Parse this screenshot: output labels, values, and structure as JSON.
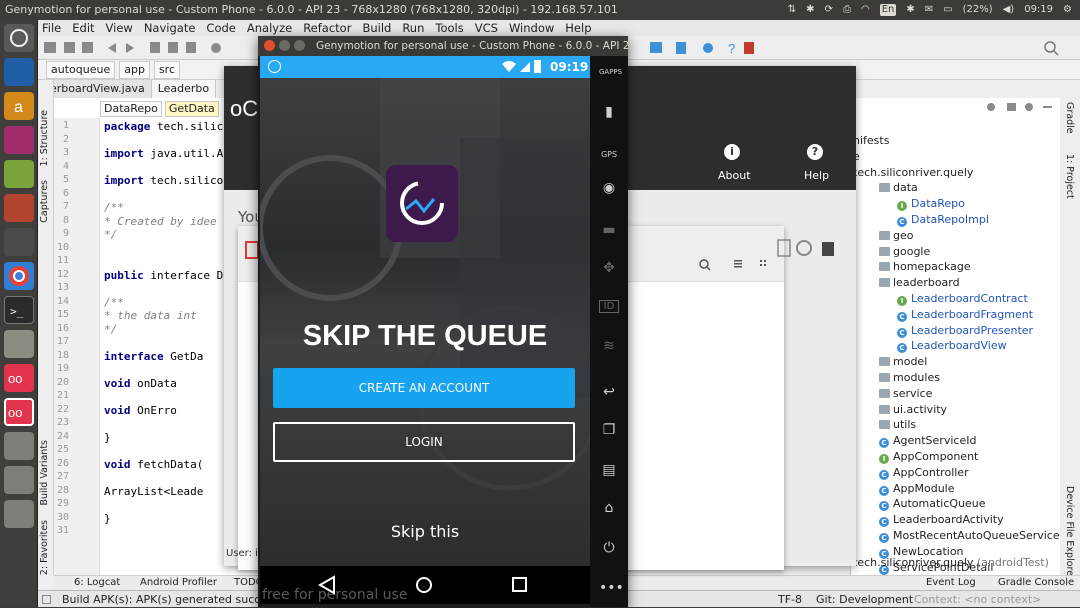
{
  "desktop": {
    "window_title": "Genymotion for personal use - Custom Phone - 6.0.0 - API 23 - 768x1280 (768x1280, 320dpi) - 192.168.57.101",
    "keyboard_layout": "En",
    "battery": "(22%)",
    "clock": "09:19"
  },
  "ide": {
    "menu": [
      "File",
      "Edit",
      "View",
      "Navigate",
      "Code",
      "Analyze",
      "Refactor",
      "Build",
      "Run",
      "Tools",
      "VCS",
      "Window",
      "Help"
    ],
    "breadcrumbs": [
      "autoqueue",
      "app",
      "src"
    ],
    "tabs": [
      "erboardView.java",
      "Leaderbo"
    ],
    "method_tabs": [
      "DataRepo",
      "GetData"
    ],
    "line_numbers": [
      "1",
      "2",
      "3",
      "4",
      "5",
      "6",
      "7",
      "8",
      "9",
      "10",
      "11",
      "12",
      "13",
      "14",
      "15",
      "16",
      "17",
      "18",
      "19",
      "20",
      "21",
      "22",
      "23",
      "24",
      "25",
      "26",
      "27",
      "28",
      "29",
      "30",
      "31"
    ],
    "code_lines": [
      {
        "line": 1,
        "text": "package tech.silico",
        "style": "kw-first"
      },
      {
        "line": 3,
        "text": "import java.util.Ar",
        "style": "kw-first"
      },
      {
        "line": 5,
        "text": "import tech.silicon",
        "style": "kw-first"
      },
      {
        "line": 7,
        "text": "/**",
        "style": "comment"
      },
      {
        "line": 8,
        "text": " * Created by idee",
        "style": "comment"
      },
      {
        "line": 9,
        "text": " */",
        "style": "comment"
      },
      {
        "line": 12,
        "text": "public interface Da",
        "style": "kw"
      },
      {
        "line": 14,
        "text": "    /**",
        "style": "comment"
      },
      {
        "line": 15,
        "text": "     * the data int",
        "style": "comment"
      },
      {
        "line": 16,
        "text": "     */",
        "style": "comment"
      },
      {
        "line": 18,
        "text": "    interface GetDa",
        "style": "kw"
      },
      {
        "line": 20,
        "text": "        void onData",
        "style": "kw"
      },
      {
        "line": 22,
        "text": "        void OnErro",
        "style": "kw"
      },
      {
        "line": 24,
        "text": "    }",
        "style": "plain"
      },
      {
        "line": 26,
        "text": "    void fetchData(",
        "style": "kw"
      },
      {
        "line": 28,
        "text": "    ArrayList<Leade",
        "style": "plain"
      },
      {
        "line": 30,
        "text": "}",
        "style": "plain"
      }
    ],
    "left_tool_labels": [
      "1: Structure",
      "Captures",
      "Build Variants",
      "2: Favorites"
    ],
    "right_tool_labels": [
      "Gradle",
      "1: Project",
      "Device File Explorer"
    ],
    "bottom_tools": [
      "6: Logcat",
      "Android Profiler",
      "TODO",
      "Event Log",
      "Gradle Console"
    ],
    "status_message": "Build APK(s): APK(s) generated successfull",
    "status_right": {
      "encoding": "TF-8",
      "git": "Git: Development",
      "context": "Context: <no context>"
    },
    "user_label": "User: id",
    "watermark": "free for personal use"
  },
  "project_tree": [
    {
      "label": "nifests",
      "kind": "plain",
      "indent": 0
    },
    {
      "label": "e",
      "kind": "plain",
      "indent": 0
    },
    {
      "label": "tech.siliconriver.quely",
      "kind": "plain",
      "indent": 0
    },
    {
      "label": "data",
      "kind": "folder",
      "indent": 1
    },
    {
      "label": "DataRepo",
      "kind": "interface",
      "indent": 2
    },
    {
      "label": "DataRepoImpl",
      "kind": "class",
      "indent": 2
    },
    {
      "label": "geo",
      "kind": "folder",
      "indent": 1
    },
    {
      "label": "google",
      "kind": "folder",
      "indent": 1
    },
    {
      "label": "homepackage",
      "kind": "folder",
      "indent": 1
    },
    {
      "label": "leaderboard",
      "kind": "folder",
      "indent": 1
    },
    {
      "label": "LeaderboardContract",
      "kind": "interface",
      "indent": 2
    },
    {
      "label": "LeaderboardFragment",
      "kind": "class",
      "indent": 2
    },
    {
      "label": "LeaderboardPresenter",
      "kind": "class",
      "indent": 2
    },
    {
      "label": "LeaderboardView",
      "kind": "class",
      "indent": 2
    },
    {
      "label": "model",
      "kind": "folder",
      "indent": 1
    },
    {
      "label": "modules",
      "kind": "folder",
      "indent": 1
    },
    {
      "label": "service",
      "kind": "folder",
      "indent": 1
    },
    {
      "label": "ui.activity",
      "kind": "folder",
      "indent": 1
    },
    {
      "label": "utils",
      "kind": "folder",
      "indent": 1
    },
    {
      "label": "AgentServiceId",
      "kind": "class-plain",
      "indent": 1
    },
    {
      "label": "AppComponent",
      "kind": "interface-plain",
      "indent": 1
    },
    {
      "label": "AppController",
      "kind": "class-plain",
      "indent": 1
    },
    {
      "label": "AppModule",
      "kind": "class-plain",
      "indent": 1
    },
    {
      "label": "AutomaticQueue",
      "kind": "class-plain",
      "indent": 1
    },
    {
      "label": "LeaderboardActivity",
      "kind": "class-plain",
      "indent": 1
    },
    {
      "label": "MostRecentAutoQueueService",
      "kind": "class-plain",
      "indent": 1
    },
    {
      "label": "NewLocation",
      "kind": "class-plain",
      "indent": 1
    },
    {
      "label": "ServicePointDetail",
      "kind": "class-plain",
      "indent": 1
    }
  ],
  "project_tree_footer": {
    "label": "tech.siliconriver.quely",
    "suffix": "(androidTest)"
  },
  "background_dialog": {
    "title": "oC",
    "about": "About",
    "help": "Help",
    "body_text": "You"
  },
  "emulator": {
    "status_time": "09:19",
    "headline": "SKIP THE QUEUE",
    "create_account": "CREATE AN ACCOUNT",
    "login": "LOGIN",
    "skip": "Skip this",
    "sidebar": [
      "GAPPS",
      "GPS",
      "ID"
    ]
  },
  "colors": {
    "android_status": "#29a8f3",
    "create_button": "#17a3ef",
    "app_icon": "#3e1a4c"
  }
}
